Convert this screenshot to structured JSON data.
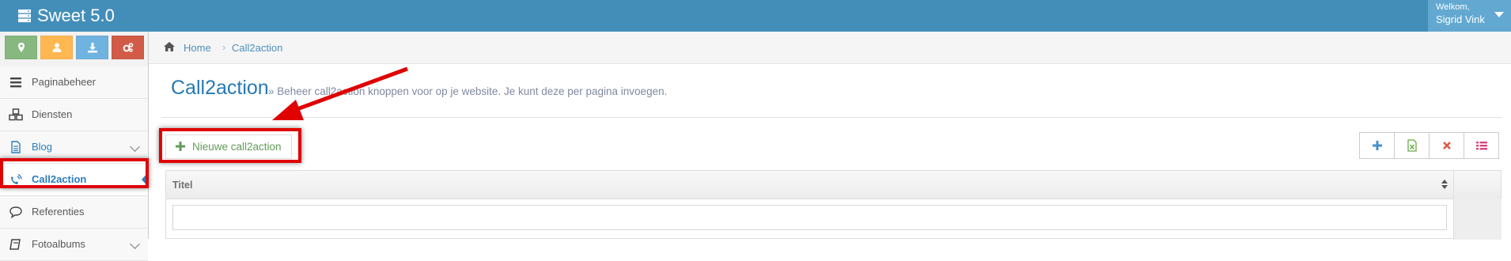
{
  "app": {
    "title": "Sweet 5.0",
    "icon": "server-icon"
  },
  "user": {
    "welcome": "Welkom,",
    "name": "Sigrid Vink",
    "icon": "chevron-down-icon"
  },
  "shortcuts": [
    {
      "icon": "map-marker-icon",
      "color": "#87b87f"
    },
    {
      "icon": "user-icon",
      "color": "#ffb752"
    },
    {
      "icon": "download-icon",
      "color": "#6fb3e0"
    },
    {
      "icon": "cogs-icon",
      "color": "#d15b47"
    }
  ],
  "sidebar": {
    "items": [
      {
        "label": "Paginabeheer",
        "icon": "bars-icon"
      },
      {
        "label": "Diensten",
        "icon": "cubes-icon"
      },
      {
        "label": "Blog",
        "icon": "file-text-icon",
        "has_submenu": true
      },
      {
        "label": "Call2action",
        "icon": "volume-control-phone-icon",
        "active": true
      },
      {
        "label": "Referenties",
        "icon": "comment-icon"
      },
      {
        "label": "Fotoalbums",
        "icon": "book-icon",
        "has_submenu": true
      }
    ]
  },
  "breadcrumb": {
    "home": "Home",
    "separator": "›",
    "current": "Call2action"
  },
  "page": {
    "title": "Call2action",
    "subtitle": "» Beheer call2action knoppen voor op je website. Je kunt deze per pagina invoegen."
  },
  "buttons": {
    "new": "Nieuwe call2action"
  },
  "toolbar": [
    {
      "icon": "plus-icon",
      "color": "#478fca"
    },
    {
      "icon": "file-excel-icon",
      "color": "#69aa46"
    },
    {
      "icon": "times-icon",
      "color": "#dd5a43"
    },
    {
      "icon": "list-icon",
      "color": "#d6487e"
    }
  ],
  "table": {
    "columns": [
      "Titel"
    ],
    "filter_placeholder": ""
  },
  "colors": {
    "navbar": "#438eb9",
    "accent": "#2679b5",
    "highlight": "#e00000"
  }
}
